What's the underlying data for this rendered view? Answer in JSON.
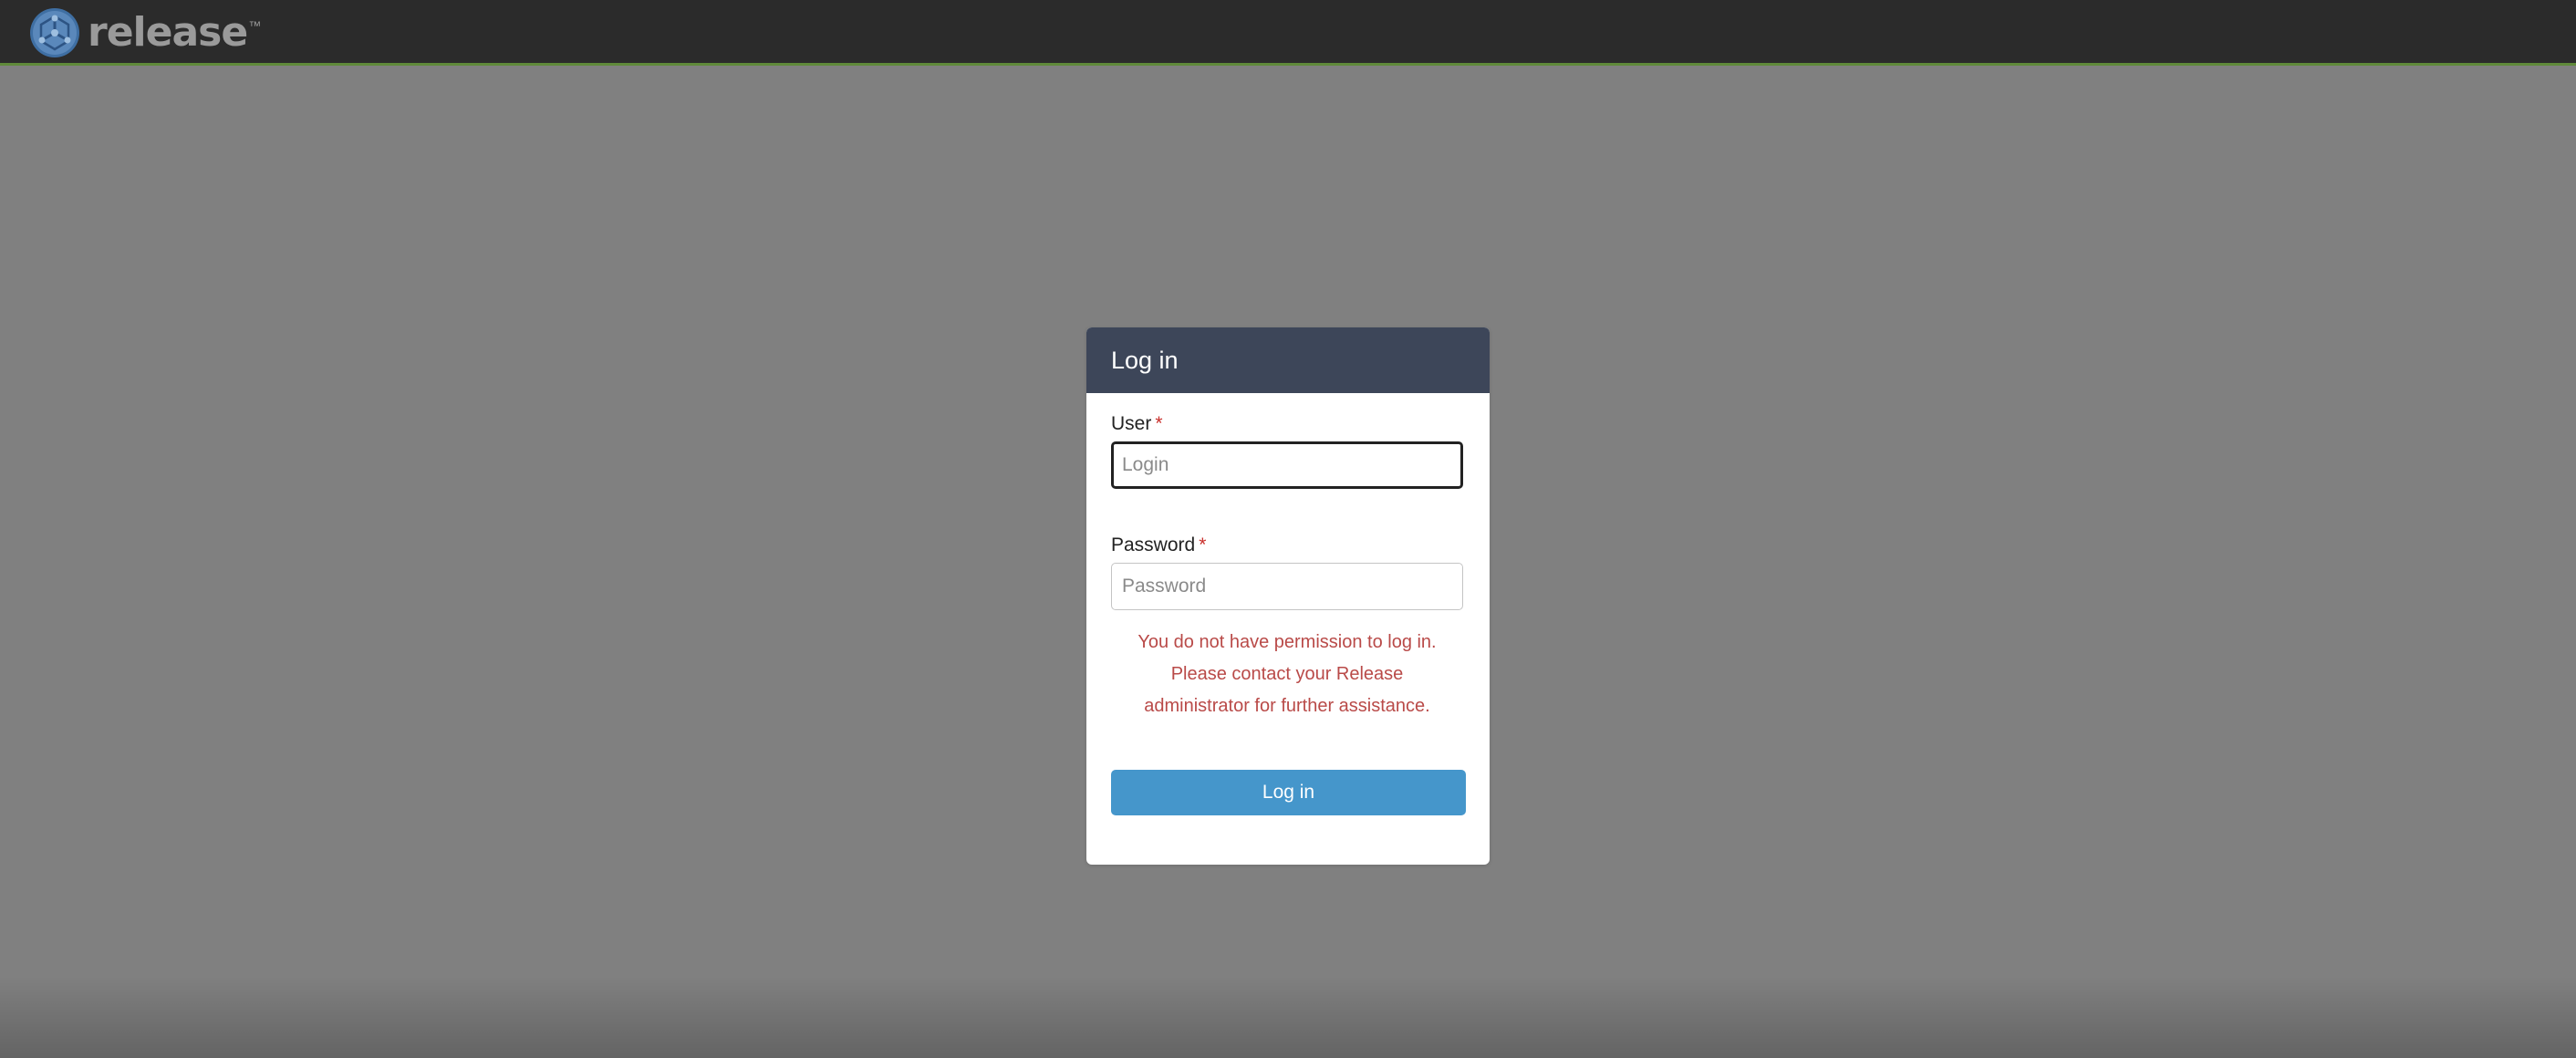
{
  "app": {
    "brand_name": "release",
    "brand_trademark": "™",
    "logo_icon": "release-cube-logo-icon"
  },
  "colors": {
    "page_background": "#808080",
    "topbar_background": "#2b2b2b",
    "topbar_accent": "#5f8a3a",
    "card_header_background": "#3d4659",
    "primary_button": "#4596cb",
    "error_text": "#b94a48",
    "required_marker": "#c9302c"
  },
  "login": {
    "title": "Log in",
    "user_label": "User",
    "user_required": "*",
    "user_value": "",
    "user_placeholder": "Login",
    "password_label": "Password",
    "password_required": "*",
    "password_value": "",
    "password_placeholder": "Password",
    "error_line1": "You do not have permission to log in.",
    "error_line2": "Please contact your Release",
    "error_line3": "administrator for further assistance.",
    "submit_label": "Log in"
  }
}
